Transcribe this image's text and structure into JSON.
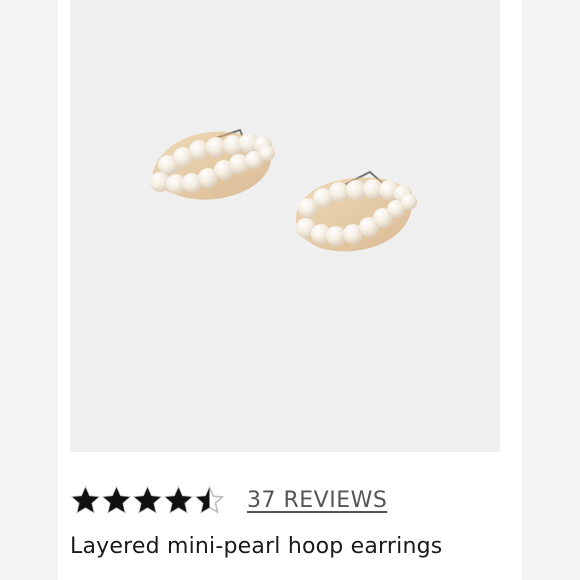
{
  "product": {
    "title": "Layered mini-pearl hoop earrings",
    "image_alt": "pearl hoop earrings"
  },
  "rating": {
    "value": 4.5,
    "max": 5,
    "reviews_label": "37 REVIEWS"
  },
  "colors": {
    "star_fill": "#111111",
    "star_empty": "#bbbbbb",
    "image_background": "#efefef",
    "side_background": "#f3f3f3",
    "pearl": "#f7f1e6",
    "gold": "#d8a25b"
  }
}
